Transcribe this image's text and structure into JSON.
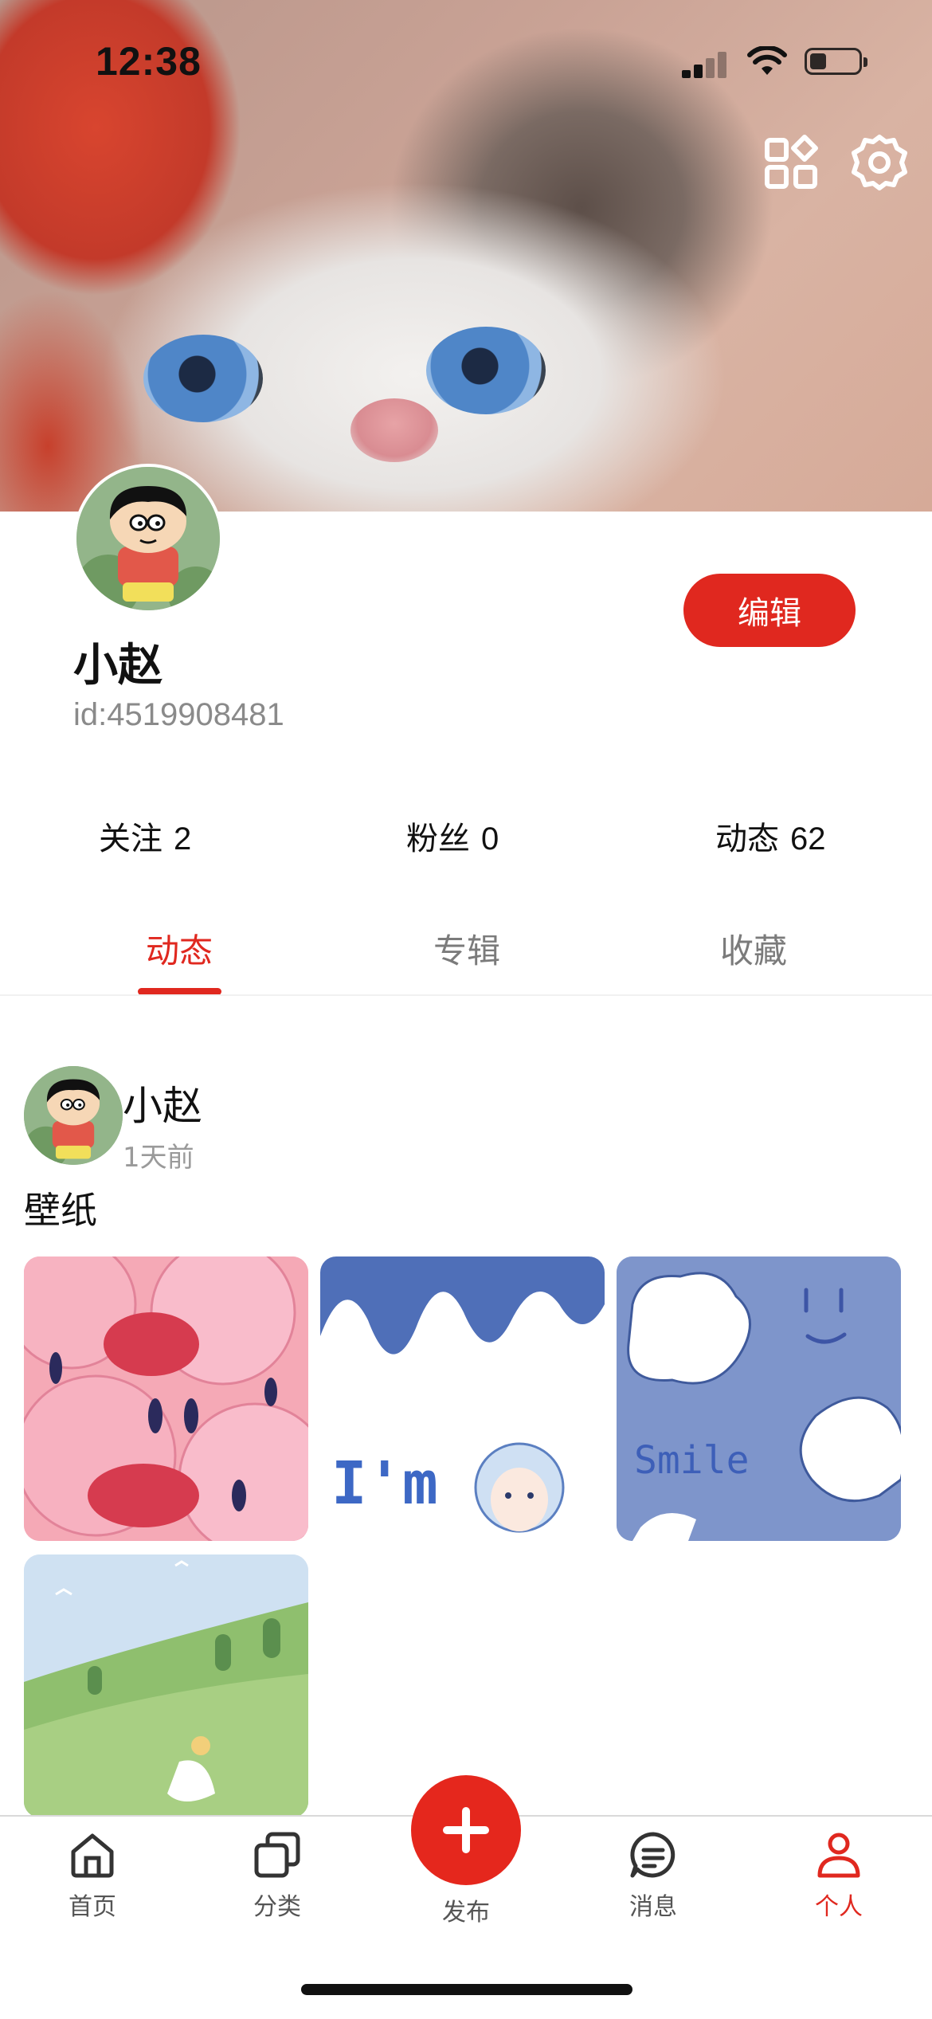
{
  "status_bar": {
    "time": "12:38"
  },
  "profile": {
    "name": "小赵",
    "id": "id:4519908481",
    "edit_label": "编辑"
  },
  "stats": [
    {
      "label": "关注",
      "value": "2"
    },
    {
      "label": "粉丝",
      "value": "0"
    },
    {
      "label": "动态",
      "value": "62"
    }
  ],
  "tabs": [
    {
      "label": "动态",
      "active": true
    },
    {
      "label": "专辑",
      "active": false
    },
    {
      "label": "收藏",
      "active": false
    }
  ],
  "post": {
    "author": "小赵",
    "time": "1天前",
    "text": "壁纸",
    "thumb_texts": {
      "im_text": "I'm",
      "smile_text": "Smile"
    }
  },
  "bottom_nav": [
    {
      "label": "首页",
      "icon": "home-icon",
      "active": false
    },
    {
      "label": "分类",
      "icon": "category-icon",
      "active": false
    },
    {
      "label": "发布",
      "icon": "plus-icon",
      "active": false
    },
    {
      "label": "消息",
      "icon": "message-icon",
      "active": false
    },
    {
      "label": "个人",
      "icon": "user-icon",
      "active": true
    }
  ],
  "colors": {
    "accent": "#e0281f",
    "text": "#111111",
    "muted": "#8a8a8a"
  }
}
